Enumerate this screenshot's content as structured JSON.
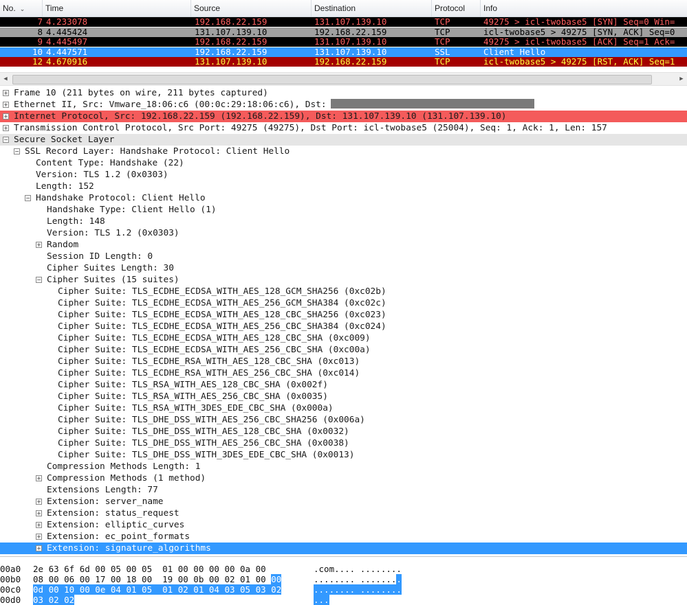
{
  "packet_list": {
    "columns": {
      "no": "No.",
      "time": "Time",
      "source": "Source",
      "destination": "Destination",
      "protocol": "Protocol",
      "info": "Info"
    },
    "sort_icon": "sort-descending-icon",
    "rows": [
      {
        "no": "7",
        "time": "4.233078",
        "source": "192.168.22.159",
        "destination": "131.107.139.10",
        "protocol": "TCP",
        "info": "49275 > icl-twobase5 [SYN] Seq=0 Win=",
        "bg": "#000000",
        "fg": "#ff5f5f"
      },
      {
        "no": "8",
        "time": "4.445424",
        "source": "131.107.139.10",
        "destination": "192.168.22.159",
        "protocol": "TCP",
        "info": "icl-twobase5 > 49275 [SYN, ACK] Seq=0",
        "bg": "#a0a0a0",
        "fg": "#000000"
      },
      {
        "no": "9",
        "time": "4.445497",
        "source": "192.168.22.159",
        "destination": "131.107.139.10",
        "protocol": "TCP",
        "info": "49275 > icl-twobase5 [ACK] Seq=1 Ack=",
        "bg": "#000000",
        "fg": "#ff5f5f"
      },
      {
        "no": "10",
        "time": "4.447571",
        "source": "192.168.22.159",
        "destination": "131.107.139.10",
        "protocol": "SSL",
        "info": "Client Hello",
        "bg": "#3399ff",
        "fg": "#ffffff"
      },
      {
        "no": "12",
        "time": "4.670916",
        "source": "131.107.139.10",
        "destination": "192.168.22.159",
        "protocol": "TCP",
        "info": "icl-twobase5 > 49275 [RST, ACK] Seq=1",
        "bg": "#a40000",
        "fg": "#ffff40"
      }
    ]
  },
  "details": [
    {
      "text": "Frame 10 (211 bytes on wire, 211 bytes captured)",
      "indent": 0,
      "state": "+"
    },
    {
      "text": "Ethernet II, Src: Vmware_18:06:c6 (00:0c:29:18:06:c6), Dst:",
      "indent": 0,
      "state": "+",
      "redacted": true
    },
    {
      "text": "Internet Protocol, Src: 192.168.22.159 (192.168.22.159), Dst: 131.107.139.10 (131.107.139.10)",
      "indent": 0,
      "state": "+",
      "bg": "#f45b5b"
    },
    {
      "text": "Transmission Control Protocol, Src Port: 49275 (49275), Dst Port: icl-twobase5 (25004), Seq: 1, Ack: 1, Len: 157",
      "indent": 0,
      "state": "+"
    },
    {
      "text": "Secure Socket Layer",
      "indent": 0,
      "state": "-",
      "bg": "#e5e5e5"
    },
    {
      "text": "SSL Record Layer: Handshake Protocol: Client Hello",
      "indent": 1,
      "state": "-"
    },
    {
      "text": "Content Type: Handshake (22)",
      "indent": 2,
      "state": ""
    },
    {
      "text": "Version: TLS 1.2 (0x0303)",
      "indent": 2,
      "state": ""
    },
    {
      "text": "Length: 152",
      "indent": 2,
      "state": ""
    },
    {
      "text": "Handshake Protocol: Client Hello",
      "indent": 2,
      "state": "-"
    },
    {
      "text": "Handshake Type: Client Hello (1)",
      "indent": 3,
      "state": ""
    },
    {
      "text": "Length: 148",
      "indent": 3,
      "state": ""
    },
    {
      "text": "Version: TLS 1.2 (0x0303)",
      "indent": 3,
      "state": ""
    },
    {
      "text": "Random",
      "indent": 3,
      "state": "+"
    },
    {
      "text": "Session ID Length: 0",
      "indent": 3,
      "state": ""
    },
    {
      "text": "Cipher Suites Length: 30",
      "indent": 3,
      "state": ""
    },
    {
      "text": "Cipher Suites (15 suites)",
      "indent": 3,
      "state": "-"
    },
    {
      "text": "Cipher Suite: TLS_ECDHE_ECDSA_WITH_AES_128_GCM_SHA256 (0xc02b)",
      "indent": 4,
      "state": ""
    },
    {
      "text": "Cipher Suite: TLS_ECDHE_ECDSA_WITH_AES_256_GCM_SHA384 (0xc02c)",
      "indent": 4,
      "state": ""
    },
    {
      "text": "Cipher Suite: TLS_ECDHE_ECDSA_WITH_AES_128_CBC_SHA256 (0xc023)",
      "indent": 4,
      "state": ""
    },
    {
      "text": "Cipher Suite: TLS_ECDHE_ECDSA_WITH_AES_256_CBC_SHA384 (0xc024)",
      "indent": 4,
      "state": ""
    },
    {
      "text": "Cipher Suite: TLS_ECDHE_ECDSA_WITH_AES_128_CBC_SHA (0xc009)",
      "indent": 4,
      "state": ""
    },
    {
      "text": "Cipher Suite: TLS_ECDHE_ECDSA_WITH_AES_256_CBC_SHA (0xc00a)",
      "indent": 4,
      "state": ""
    },
    {
      "text": "Cipher Suite: TLS_ECDHE_RSA_WITH_AES_128_CBC_SHA (0xc013)",
      "indent": 4,
      "state": ""
    },
    {
      "text": "Cipher Suite: TLS_ECDHE_RSA_WITH_AES_256_CBC_SHA (0xc014)",
      "indent": 4,
      "state": ""
    },
    {
      "text": "Cipher Suite: TLS_RSA_WITH_AES_128_CBC_SHA (0x002f)",
      "indent": 4,
      "state": ""
    },
    {
      "text": "Cipher Suite: TLS_RSA_WITH_AES_256_CBC_SHA (0x0035)",
      "indent": 4,
      "state": ""
    },
    {
      "text": "Cipher Suite: TLS_RSA_WITH_3DES_EDE_CBC_SHA (0x000a)",
      "indent": 4,
      "state": ""
    },
    {
      "text": "Cipher Suite: TLS_DHE_DSS_WITH_AES_256_CBC_SHA256 (0x006a)",
      "indent": 4,
      "state": ""
    },
    {
      "text": "Cipher Suite: TLS_DHE_DSS_WITH_AES_128_CBC_SHA (0x0032)",
      "indent": 4,
      "state": ""
    },
    {
      "text": "Cipher Suite: TLS_DHE_DSS_WITH_AES_256_CBC_SHA (0x0038)",
      "indent": 4,
      "state": ""
    },
    {
      "text": "Cipher Suite: TLS_DHE_DSS_WITH_3DES_EDE_CBC_SHA (0x0013)",
      "indent": 4,
      "state": ""
    },
    {
      "text": "Compression Methods Length: 1",
      "indent": 3,
      "state": ""
    },
    {
      "text": "Compression Methods (1 method)",
      "indent": 3,
      "state": "+"
    },
    {
      "text": "Extensions Length: 77",
      "indent": 3,
      "state": ""
    },
    {
      "text": "Extension: server_name",
      "indent": 3,
      "state": "+"
    },
    {
      "text": "Extension: status_request",
      "indent": 3,
      "state": "+"
    },
    {
      "text": "Extension: elliptic_curves",
      "indent": 3,
      "state": "+"
    },
    {
      "text": "Extension: ec_point_formats",
      "indent": 3,
      "state": "+"
    },
    {
      "text": "Extension: signature_algorithms",
      "indent": 3,
      "state": "+",
      "selected": true
    }
  ],
  "hex": [
    {
      "offset": "00a0",
      "plain": "2e 63 6f 6d 00 05 00 05  01 00 00 00 00 0a 00",
      "sel": "",
      "ascii_plain": ".com.... ........",
      "ascii_sel": ""
    },
    {
      "offset": "00b0",
      "plain": "08 00 06 00 17 00 18 00  19 00 0b 00 02 01 00 ",
      "sel": "00",
      "ascii_plain": "........ .......",
      "ascii_sel": "."
    },
    {
      "offset": "00c0",
      "plain": "",
      "sel": "0d 00 10 00 0e 04 01 05  01 02 01 04 03 05 03 02",
      "ascii_plain": "",
      "ascii_sel": "........ ........"
    },
    {
      "offset": "00d0",
      "plain": "",
      "sel": "03 02 02",
      "ascii_plain": "",
      "ascii_sel": "..."
    }
  ],
  "colors": {
    "selection": "#3399ff",
    "ip_highlight": "#f45b5b"
  }
}
